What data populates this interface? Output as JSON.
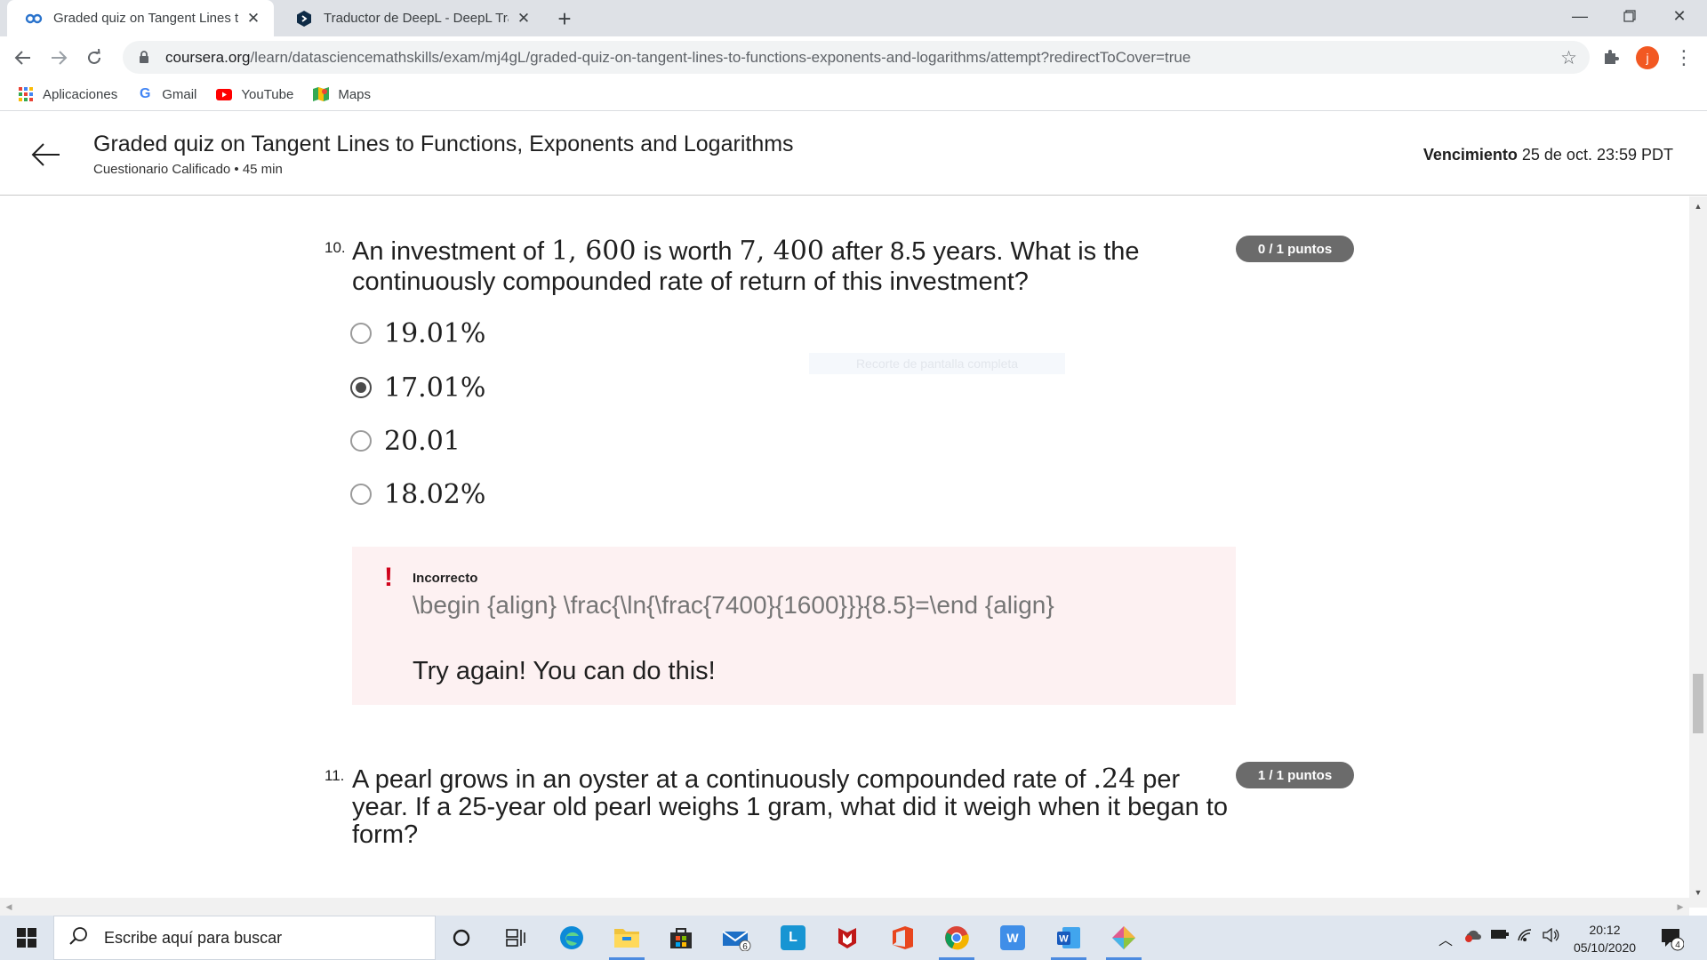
{
  "browser": {
    "tabs": [
      {
        "title": "Graded quiz on Tangent Lines to Functions, Exponents and Logarithms | Coursera",
        "active": true,
        "icon": "coursera-icon"
      },
      {
        "title": "Traductor de DeepL - DeepL Translate",
        "active": false,
        "icon": "deepl-icon"
      }
    ],
    "new_tab_label": "+",
    "url_host": "coursera.org",
    "url_path": "/learn/datasciencemathskills/exam/mj4gL/graded-quiz-on-tangent-lines-to-functions-exponents-and-logarithms/attempt?redirectToCover=true",
    "profile_initial": "j",
    "bookmarks": [
      {
        "label": "Aplicaciones",
        "icon": "apps-grid-icon"
      },
      {
        "label": "Gmail",
        "icon": "google-icon"
      },
      {
        "label": "YouTube",
        "icon": "youtube-icon"
      },
      {
        "label": "Maps",
        "icon": "maps-icon"
      }
    ]
  },
  "header": {
    "title": "Graded quiz on Tangent Lines to Functions, Exponents and Logarithms",
    "subtitle": "Cuestionario Calificado • 45 min",
    "due_label": "Vencimiento",
    "due_value": "25 de oct. 23:59 PDT"
  },
  "questions": [
    {
      "number": "10.",
      "text_parts": [
        "An investment of ",
        "1, 600",
        " is worth ",
        "7, 400",
        " after 8.5 years. What is the continuously compounded rate of return of this investment?"
      ],
      "points": "0 / 1 puntos",
      "options": [
        {
          "label": "19.01%",
          "selected": false
        },
        {
          "label": "17.01%",
          "selected": true
        },
        {
          "label": "20.01",
          "selected": false
        },
        {
          "label": "18.02%",
          "selected": false
        }
      ],
      "feedback": {
        "status": "Incorrecto",
        "code": "\\begin {align} \\frac{\\ln{\\frac{7400}{1600}}}{8.5}=\\end {align}",
        "message": "Try again! You can do this!"
      }
    },
    {
      "number": "11.",
      "text_parts": [
        "A pearl grows in an oyster at a continuously compounded rate of ",
        ".24",
        " per year. If a 25-year old pearl weighs 1 gram, what did it weigh when it began to form?"
      ],
      "points": "1 / 1 puntos"
    }
  ],
  "overlay_hint": "Recorte de pantalla completa",
  "taskbar": {
    "search_placeholder": "Escribe aquí para buscar",
    "mail_badge": "6",
    "time": "20:12",
    "date": "05/10/2020",
    "notification_count": "4"
  },
  "colors": {
    "points_badge": "#6b6b6b",
    "feedback_bg": "#fdf1f2",
    "error_red": "#d0021b",
    "profile": "#f25822"
  }
}
